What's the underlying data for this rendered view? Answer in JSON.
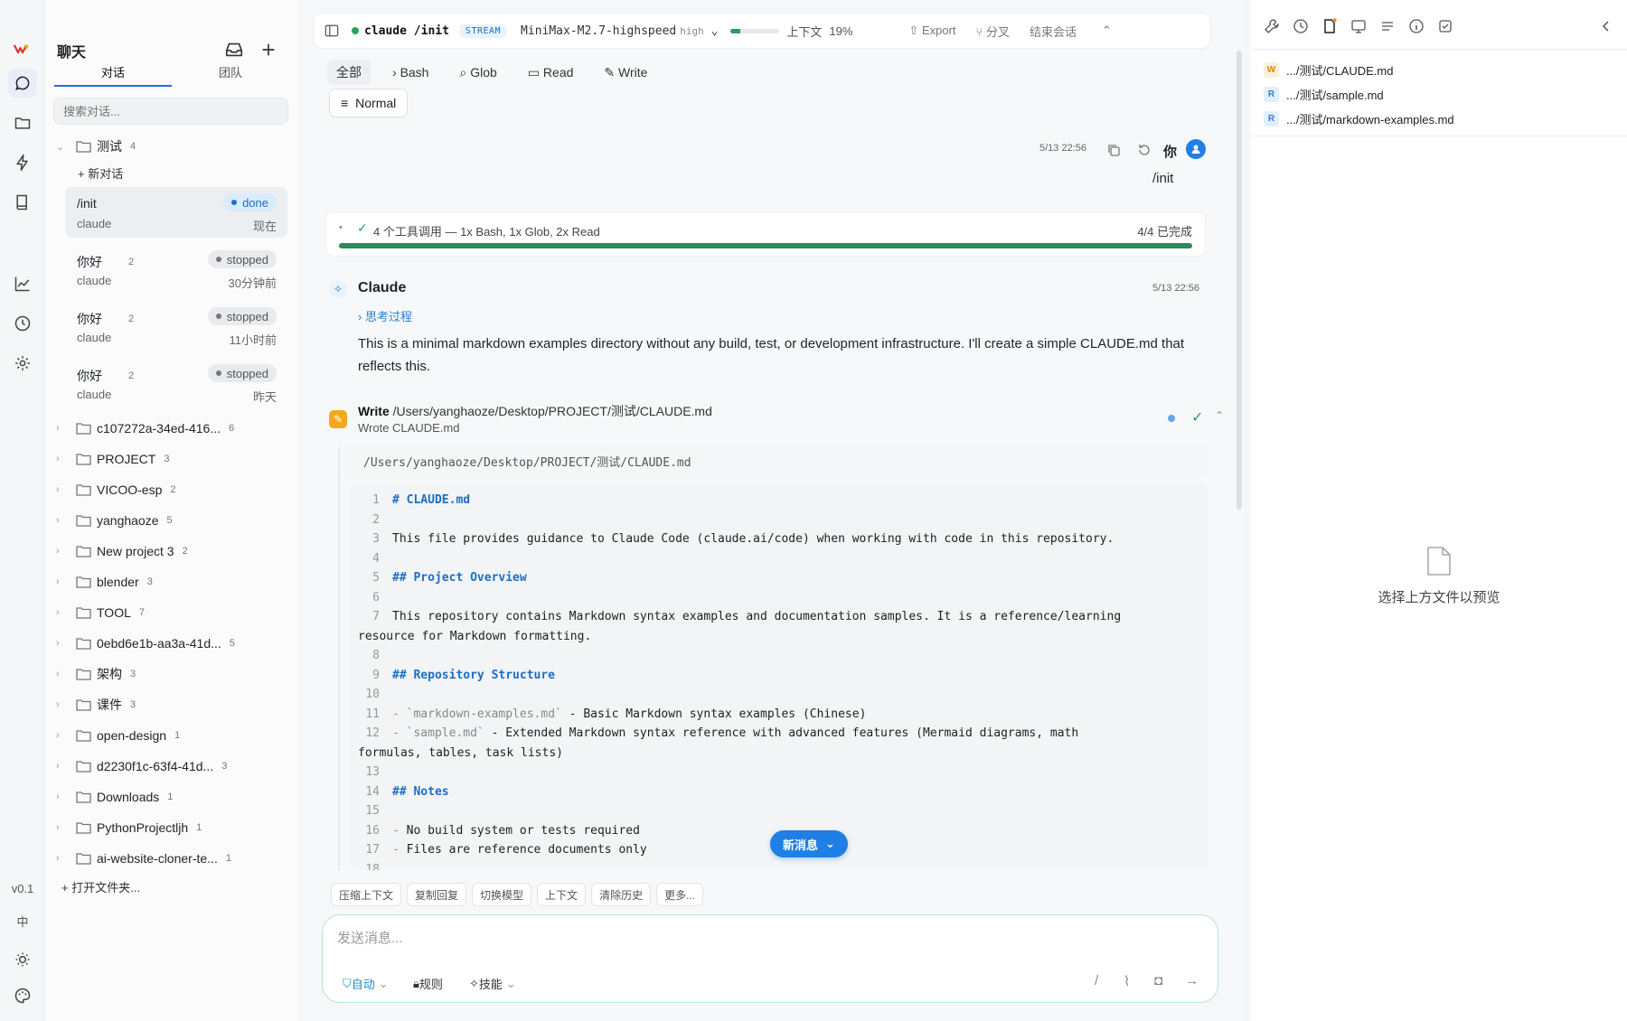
{
  "sidebar": {
    "title": "聊天",
    "tabs": [
      "对话",
      "团队"
    ],
    "search_placeholder": "搜索对话...",
    "new_conversation": "新对话",
    "open_folder": "打开文件夹...",
    "version": "v0.1",
    "lang": "中",
    "group": {
      "name": "测试",
      "count": "4"
    },
    "conversations": [
      {
        "title": "/init",
        "count": "",
        "sub": "claude",
        "status": "done",
        "time": "现在"
      },
      {
        "title": "你好",
        "count": "2",
        "sub": "claude",
        "status": "stopped",
        "time": "30分钟前"
      },
      {
        "title": "你好",
        "count": "2",
        "sub": "claude",
        "status": "stopped",
        "time": "11小时前"
      },
      {
        "title": "你好",
        "count": "2",
        "sub": "claude",
        "status": "stopped",
        "time": "昨天"
      }
    ],
    "folders": [
      {
        "name": "c107272a-34ed-416...",
        "count": "6"
      },
      {
        "name": "PROJECT",
        "count": "3"
      },
      {
        "name": "VICOO-esp",
        "count": "2"
      },
      {
        "name": "yanghaoze",
        "count": "5"
      },
      {
        "name": "New project 3",
        "count": "2"
      },
      {
        "name": "blender",
        "count": "3"
      },
      {
        "name": "TOOL",
        "count": "7"
      },
      {
        "name": "0ebd6e1b-aa3a-41d...",
        "count": "5"
      },
      {
        "name": "架构",
        "count": "3"
      },
      {
        "name": "课件",
        "count": "3"
      },
      {
        "name": "open-design",
        "count": "1"
      },
      {
        "name": "d2230f1c-63f4-41d...",
        "count": "3"
      },
      {
        "name": "Downloads",
        "count": "1"
      },
      {
        "name": "PythonProjectljh",
        "count": "1"
      },
      {
        "name": "ai-website-cloner-te...",
        "count": "1"
      }
    ]
  },
  "topbar": {
    "title": "claude /init",
    "stream": "STREAM",
    "model": "MiniMax-M2.7-highspeed",
    "effort": "high",
    "context_label": "上下文",
    "context_pct": "19%",
    "context_fraction": 0.19,
    "export": "Export",
    "branch": "分叉",
    "end": "结束会话"
  },
  "filters": [
    "全部",
    "Bash",
    "Glob",
    "Read",
    "Write"
  ],
  "mode": "Normal",
  "user_msg": {
    "time": "5/13 22:56",
    "name": "你",
    "text": "/init"
  },
  "tools": {
    "label": "4 个工具调用 — 1x Bash, 1x Glob, 2x Read",
    "status": "4/4 已完成",
    "fraction": 1.0
  },
  "assistant": {
    "name": "Claude",
    "time": "5/13 22:56",
    "thinking": "思考过程",
    "text": "This is a minimal markdown examples directory without any build, test, or development infrastructure. I'll create a simple CLAUDE.md that reflects this."
  },
  "write_tool": {
    "label": "Write",
    "path": "/Users/yanghaoze/Desktop/PROJECT/测试/CLAUDE.md",
    "result": "Wrote CLAUDE.md"
  },
  "code": {
    "path": "/Users/yanghaoze/Desktop/PROJECT/测试/CLAUDE.md",
    "lines": [
      {
        "n": "1",
        "t": "# CLAUDE.md",
        "k": "h"
      },
      {
        "n": "2",
        "t": "",
        "k": ""
      },
      {
        "n": "3",
        "t": "This file provides guidance to Claude Code (claude.ai/code) when working with code in this repository.",
        "k": ""
      },
      {
        "n": "4",
        "t": "",
        "k": ""
      },
      {
        "n": "5",
        "t": "## Project Overview",
        "k": "h"
      },
      {
        "n": "6",
        "t": "",
        "k": ""
      },
      {
        "n": "7",
        "t": "This repository contains Markdown syntax examples and documentation samples. It is a reference/learning",
        "k": "",
        "wrap": "resource for Markdown formatting."
      },
      {
        "n": "8",
        "t": "",
        "k": ""
      },
      {
        "n": "9",
        "t": "## Repository Structure",
        "k": "h"
      },
      {
        "n": "10",
        "t": "",
        "k": ""
      },
      {
        "n": "11",
        "t": "`markdown-examples.md` - Basic Markdown syntax examples (Chinese)",
        "k": "li",
        "code": "`markdown-examples.md`",
        "rest": " - Basic Markdown syntax examples (Chinese)"
      },
      {
        "n": "12",
        "t": "`sample.md` - Extended Markdown syntax reference with advanced features (Mermaid diagrams, math",
        "k": "li",
        "code": "`sample.md`",
        "rest": " - Extended Markdown syntax reference with advanced features (Mermaid diagrams, math",
        "wrap": "formulas, tables, task lists)"
      },
      {
        "n": "13",
        "t": "",
        "k": ""
      },
      {
        "n": "14",
        "t": "## Notes",
        "k": "h"
      },
      {
        "n": "15",
        "t": "",
        "k": ""
      },
      {
        "n": "16",
        "t": "No build system or tests required",
        "k": "li",
        "code": "",
        "rest": "No build system or tests required"
      },
      {
        "n": "17",
        "t": "Files are reference documents only",
        "k": "li",
        "code": "",
        "rest": "Files are reference documents only"
      },
      {
        "n": "18",
        "t": "",
        "k": ""
      }
    ]
  },
  "new_message": "新消息",
  "quick_actions": [
    "压缩上下文",
    "复制回复",
    "切换模型",
    "上下文",
    "清除历史",
    "更多..."
  ],
  "composer": {
    "placeholder": "发送消息...",
    "auto": "自动",
    "rules": "规则",
    "skills": "技能"
  },
  "right_panel": {
    "files": [
      {
        "tag": "W",
        "name": ".../测试/CLAUDE.md"
      },
      {
        "tag": "R",
        "name": ".../测试/sample.md"
      },
      {
        "tag": "R",
        "name": ".../测试/markdown-examples.md"
      }
    ],
    "empty": "选择上方文件以预览"
  }
}
